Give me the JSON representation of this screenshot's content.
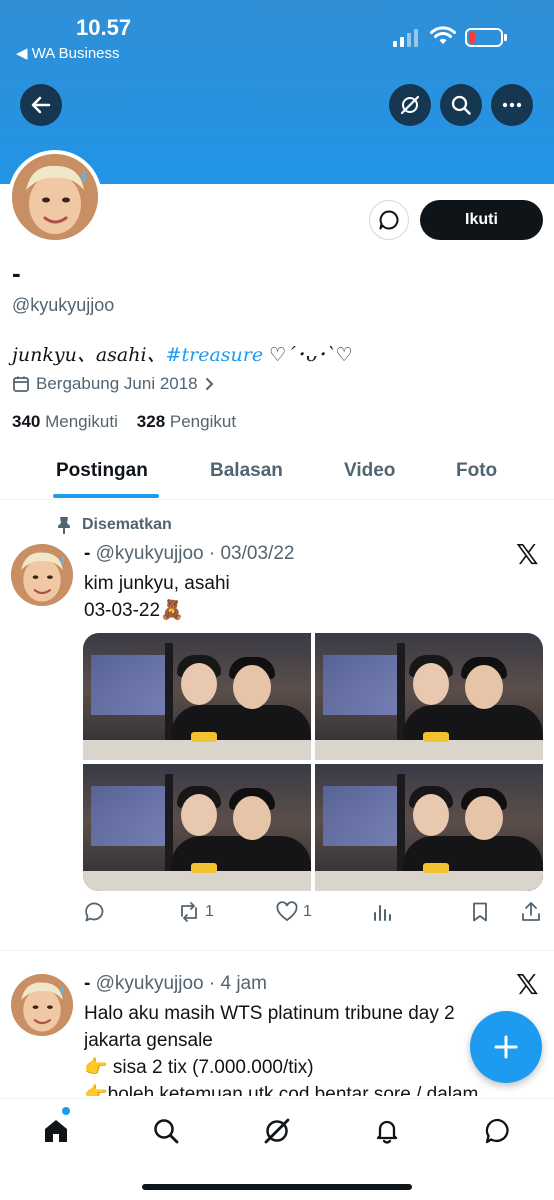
{
  "status_bar": {
    "time": "10.57",
    "back_app": "◀ WA Business"
  },
  "profile": {
    "display_name": "-",
    "handle": "@kyukyujjoo",
    "bio_prefix": "junkyu、asahi、",
    "bio_hashtag": "#treasure",
    "bio_suffix": " ♡´･ᴗ･`♡",
    "joined": "Bergabung Juni 2018",
    "following_count": "340",
    "following_label": "Mengikuti",
    "followers_count": "328",
    "followers_label": "Pengikut",
    "follow_label": "Ikuti"
  },
  "tabs": [
    {
      "label": "Postingan"
    },
    {
      "label": "Balasan"
    },
    {
      "label": "Video"
    },
    {
      "label": "Foto"
    }
  ],
  "posts": [
    {
      "pinned_label": "Disematkan",
      "name": "-",
      "handle_time": "@kyukyujjoo · 03/03/22",
      "lines": [
        "kim junkyu, asahi",
        "03-03-22🧸"
      ],
      "replies": "",
      "reposts": "1",
      "likes": "1"
    },
    {
      "name": "-",
      "handle_time": "@kyukyujjoo · 4 jam",
      "lines": [
        "Halo aku masih WTS platinum tribune day 2",
        "jakarta gensale",
        "👉 sisa 2 tix (7.000.000/tix)",
        "👉boleh ketemuan utk cod bentar sore / dalam"
      ]
    }
  ],
  "colors": {
    "accent": "#1d9bf0",
    "banner": "#2394e6",
    "text": "#0f1419",
    "muted": "#536471"
  }
}
